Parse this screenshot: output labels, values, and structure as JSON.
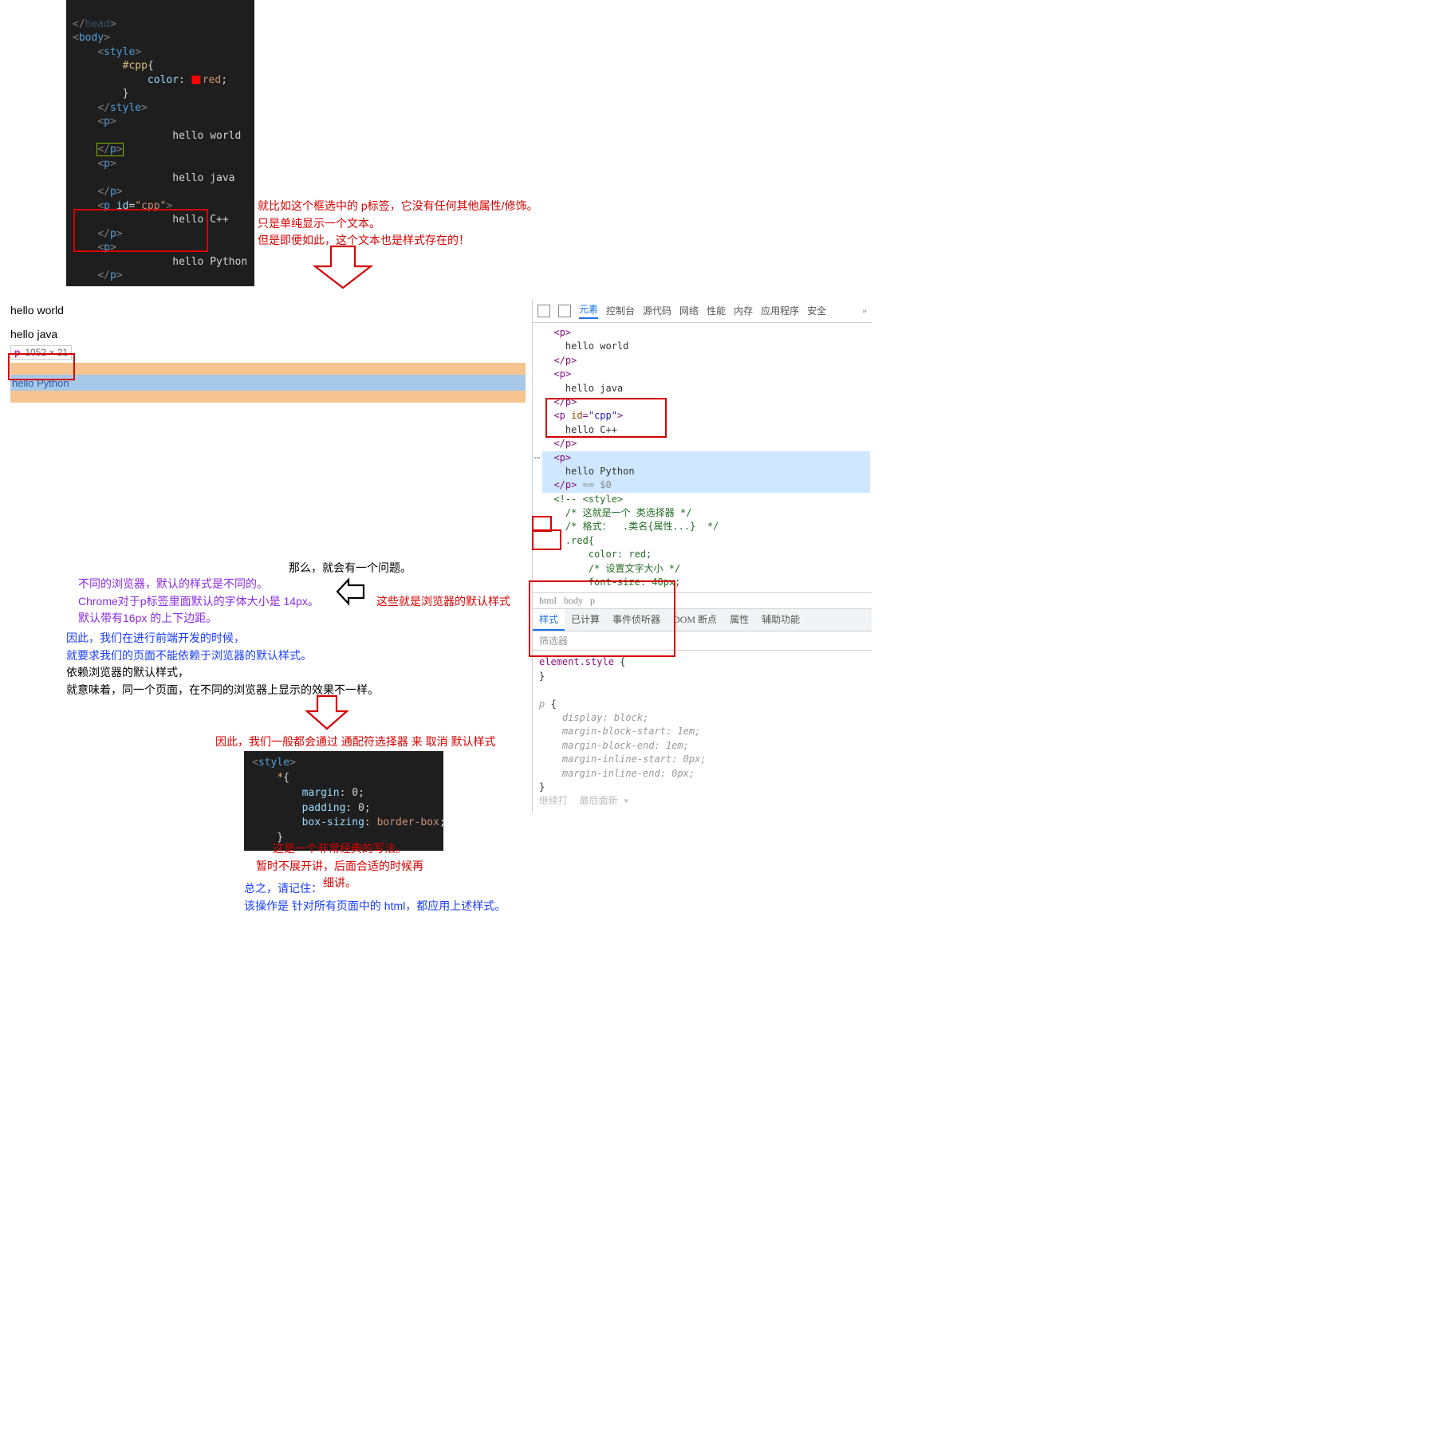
{
  "editor1": {
    "l1": "</head>",
    "l2": "<body>",
    "l3": "    <style>",
    "l4": "        #cpp{",
    "l5a": "            color: ",
    "l5b": "red;",
    "l6": "        }",
    "l7": "    </style>",
    "l8": "    <p>",
    "l9": "        hello world",
    "l10": "    </p>",
    "l11": "    <p>",
    "l12": "        hello java",
    "l13": "    </p>",
    "l14a": "    <p ",
    "l14b": "id=",
    "l14c": "\"cpp\"",
    "l14d": ">",
    "l15": "        hello C++",
    "l16": "    </p>",
    "l17": "    <p>",
    "l18": "        hello Python",
    "l19": "    </p>"
  },
  "note1": {
    "l1": "就比如这个框选中的 p标签，它没有任何其他属性/修饰。",
    "l2": "只是单纯显示一个文本。",
    "l3": "但是即便如此，这个文本也是样式存在的！"
  },
  "browserLeft": {
    "hw": "hello world",
    "hj": "hello java",
    "tipTag": "p",
    "tipSize": "1052 × 21",
    "hp": "hello Python"
  },
  "dev": {
    "tabs": [
      "元素",
      "控制台",
      "源代码",
      "网络",
      "性能",
      "内存",
      "应用程序",
      "安全"
    ],
    "dom": {
      "p": "<p>",
      "pc": "</p>",
      "hw": "    hello world",
      "hj": "    hello java",
      "pcpp": "<p id=\"cpp\">",
      "hc": "    hello C++",
      "hp": "    hello Python",
      "eq": "</p> == $0",
      "cmt1": "<!-- <style>",
      "cmt2": "    /* 这就是一个 类选择器 */",
      "cmt3": "    /* 格式：  .类名{属性...}  */",
      "cmt4": "    .red{",
      "cmt5": "        color: red;",
      "cmt6": "        /* 设置文字大小 */",
      "cmt7": "        font-size: 40px;"
    },
    "bc": [
      "html",
      "body",
      "p"
    ],
    "sub": [
      "样式",
      "已计算",
      "事件侦听器",
      "DOM 断点",
      "属性",
      "辅助功能"
    ],
    "filter": "筛选器",
    "styles": {
      "es": "element.style {",
      "esc": "}",
      "p": "p {",
      "d": "    display: block;",
      "m1": "    margin-block-start: 1em;",
      "m2": "    margin-block-end: 1em;",
      "m3": "    margin-inline-start: 0px;",
      "m4": "    margin-inline-end: 0px;",
      "pc": "}",
      "foot": "继续打  最后面新 ▾"
    }
  },
  "mid": {
    "q": "那么，就会有一个问题。",
    "defnote": "这些就是浏览器的默认样式"
  },
  "purple": {
    "l1": "不同的浏览器，默认的样式是不同的。",
    "l2": "Chrome对于p标签里面默认的字体大小是  14px。",
    "l3": "默认带有16px  的上下边距。"
  },
  "blue": {
    "l1": "因此，我们在进行前端开发的时候，",
    "l2": "就要求我们的页面不能依赖于浏览器的默认样式。"
  },
  "black": {
    "l1": "依赖浏览器的默认样式，",
    "l2": "就意味着，同一个页面，在不同的浏览器上显示的效果不一样。"
  },
  "red2": "因此，我们一般都会通过 通配符选择器 来 取消 默认样式",
  "editor2": {
    "l1": "<style>",
    "l2": "    *{",
    "l3": "        margin: 0;",
    "l4": "        padding: 0;",
    "l5a": "        box-sizing: ",
    "l5b": "border-box;",
    "l6": "    }"
  },
  "note3": {
    "l1": "这是一个非常经典的写法。",
    "l2": "暂时不展开讲，后面合适的时候再细讲。"
  },
  "note4": {
    "l1": "总之，请记住：",
    "l2": "该操作是 针对所有页面中的 html，都应用上述样式。"
  }
}
